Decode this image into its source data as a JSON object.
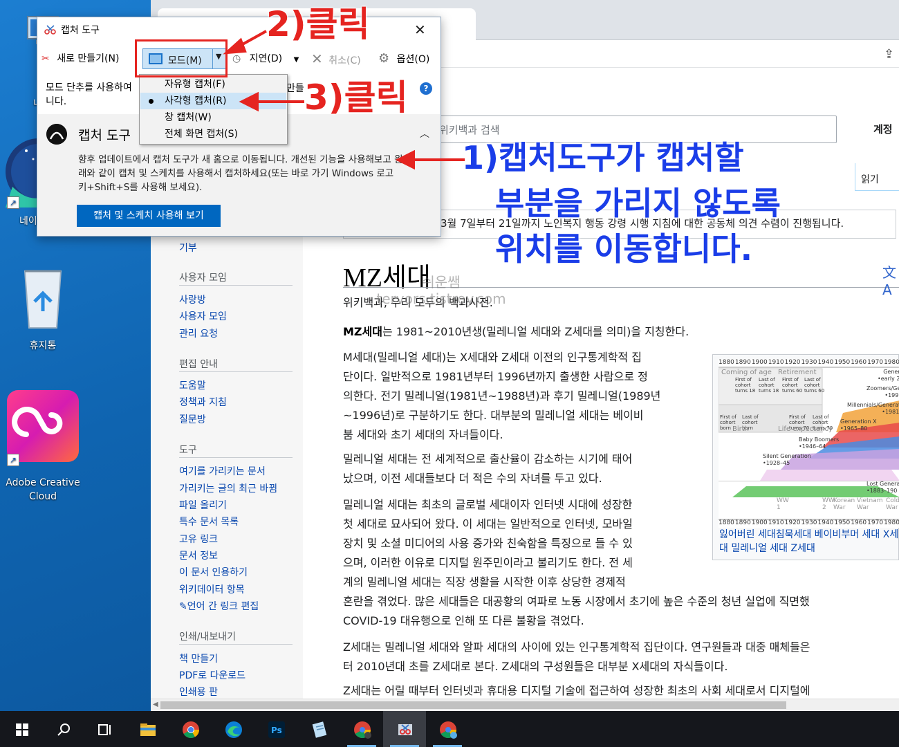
{
  "desktop": {
    "icons": [
      {
        "label": "내"
      },
      {
        "label": "네이"
      },
      {
        "label": "휴지통"
      },
      {
        "label": "Adobe Creative Cloud"
      }
    ]
  },
  "wiki": {
    "search_placeholder": "위키백과 검색",
    "account": "계정",
    "read_tab": "읽기",
    "sitenotice": "3월 7일부터 21일까지 노인복지 행동 강령 시행 지침에 대한 공동체 의견 수렴이 진행됩니다.",
    "sidebar": {
      "donate": "기부",
      "community_title": "사용자 모임",
      "community_links": [
        "사랑방",
        "사용자 모임",
        "관리 요청"
      ],
      "help_title": "편집 안내",
      "help_links": [
        "도움말",
        "정책과 지침",
        "질문방"
      ],
      "tools_title": "도구",
      "tools_links": [
        "여기를 가리키는 문서",
        "가리키는 글의 최근 바뀜",
        "파일 올리기",
        "특수 문서 목록",
        "고유 링크",
        "문서 정보",
        "이 문서 인용하기",
        "위키데이터 항목",
        "언어 간 링크 편집"
      ],
      "print_title": "인쇄/내보내기",
      "print_links": [
        "책 만들기",
        "PDF로 다운로드",
        "인쇄용 판"
      ]
    },
    "title": "MZ세대",
    "from": "위키백과, 우리 모두의 백과사전.",
    "watermark_line1": "쉬운쌤",
    "watermark_line2": "tervors.tistroy.com",
    "intro_bold": "MZ세대",
    "intro_rest": "는 1981~2010년생(밀레니얼 세대와 Z세대를 의미)을 지칭한다.",
    "paragraphs": [
      [
        "M세대(밀레니얼 세대)는 X세대와 Z세대 이전의 인구통계학적 집",
        "단이다. 일반적으로 1981년부터 1996년까지 출생한 사람으로 정",
        "의한다. 전기 밀레니얼(1981년~1988년)과 후기 밀레니얼(1989년",
        "~1996년)로 구분하기도 한다. 대부분의 밀레니얼 세대는 베이비",
        "붐 세대와 초기 세대의 자녀들이다."
      ],
      [
        "밀레니얼 세대는 전 세계적으로 출산율이 감소하는 시기에 태어",
        "났으며, 이전 세대들보다 더 적은 수의 자녀를 두고 있다."
      ],
      [
        "밀레니얼 세대는 최초의 글로벌 세대이자 인터넷 시대에 성장한",
        "첫 세대로 묘사되어 왔다. 이 세대는 일반적으로 인터넷, 모바일",
        "장치 및 소셜 미디어의 사용 증가와 친숙함을 특징으로 들 수 있",
        "으며, 이러한 이유로 디지털 원주민이라고 불리기도 한다. 전 세",
        "계의 밀레니얼 세대는 직장 생활을 시작한 이후 상당한 경제적",
        "혼란을 겪었다. 많은 세대들은 대공황의 여파로 노동 시장에서 초기에 높은 수준의 청년 실업에 직면했",
        "COVID-19 대유행으로 인해 또 다른 불황을 겪었다."
      ],
      [
        "Z세대는 밀레니얼 세대와 알파 세대의 사이에 있는 인구통계학적 집단이다. 연구원들과 대중 매체들은",
        "터 2010년대 초를 Z세대로 본다. Z세대의 구성원들은 대부분 X세대의 자식들이다."
      ],
      [
        "Z세대는 어릴 때부터 인터넷과 휴대용 디지털 기술에 접근하여 성장한 최초의 사회 세대로서 디지털에"
      ]
    ],
    "figure": {
      "years": [
        "1880",
        "1890",
        "1900",
        "1910",
        "1920",
        "1930",
        "1940",
        "1950",
        "1960",
        "1970",
        "1980"
      ],
      "labels": {
        "coming_of_age": "Coming of age",
        "retirement": "Retirement",
        "birth": "Birth",
        "life_expectancy": "Life expectancy",
        "generation_z": "Genera\n•early 20",
        "zoomers": "Zoomers/Gen\n•1997-",
        "millennials": "Millennials/Generation\n•1981–96",
        "gen_x": "Generation X\n•1965–80",
        "boomers": "Baby Boomers\n•1946–64",
        "silent": "Silent Generation\n•1928–45",
        "lost": "Lost Generati\n•1883–190",
        "ww1": "WW\n1",
        "ww2": "WW\n2",
        "korean": "Korean\nWar",
        "vietnam": "Vietnam\nWar",
        "cold": "Cold\nWar",
        "first_cohort_turns18": "First of\ncohort\nturns 18",
        "last_cohort_turns18": "Last of\ncohort\nturns 18",
        "first_cohort_turns60": "First of\ncohort\nturns 60",
        "last_cohort_turns60": "Last of\ncohort\nturns 60",
        "first_cohort_born": "First of\ncohort\nborn",
        "last_cohort_born": "Last of\ncohort\nborn",
        "first_cohort_turns70": "First of\ncohort\nturns 70",
        "last_cohort_turns70": "Last of\ncohort\nturns 70"
      },
      "caption": "잃어버린 세대침묵세대 베이비부머 세대 X세대 밀레니얼 세대 Z세대"
    }
  },
  "snip": {
    "title": "캡처 도구",
    "new_label": "새로 만들기(N)",
    "mode_label": "모드(M)",
    "delay_label": "지연(D)",
    "cancel_label": "취소(C)",
    "options_label": "옵션(O)",
    "help_text": "모드 단추를 사용하여 캡처 유형을 선택하세요. 입력하거나 만들기를 선택합니다.",
    "help_text_visible_a": "모드 단추를 사용하여",
    "help_text_visible_b": "니다.",
    "help_text_visible_c": "만들",
    "notice_title": "캡처 도구",
    "notice_body": "향후 업데이트에서 캡처 도구가 새 홈으로 이동됩니다. 개선된 기능을 사용해보고 원래와 같이 캡처 및 스케치를 사용해서 캡처하세요(또는 바로 가기 Windows 로고 키+Shift+S를 사용해 보세요).",
    "notice_button": "캡처 및 스케치 사용해 보기",
    "menu": [
      {
        "label": "자유형 캡처(F)",
        "selected": false
      },
      {
        "label": "사각형 캡처(R)",
        "selected": true
      },
      {
        "label": "창 캡처(W)",
        "selected": false
      },
      {
        "label": "전체 화면 캡처(S)",
        "selected": false
      }
    ]
  },
  "annotations": {
    "step1_line1": "1)캡처도구가 캡처할",
    "step1_line2": "부분을 가리지 않도록",
    "step1_line3": "위치를 이동합니다.",
    "step2": "2)클릭",
    "step3": "3)클릭",
    "red": "#e52420",
    "blue": "#1a3de8"
  },
  "taskbar": {
    "items": [
      "start-icon",
      "search-icon",
      "task-view-icon",
      "file-explorer-icon",
      "chrome-icon",
      "edge-icon",
      "photoshop-icon",
      "notepad-icon",
      "chrome-profile-icon",
      "snipping-tool-icon",
      "chrome-profile2-icon"
    ]
  }
}
